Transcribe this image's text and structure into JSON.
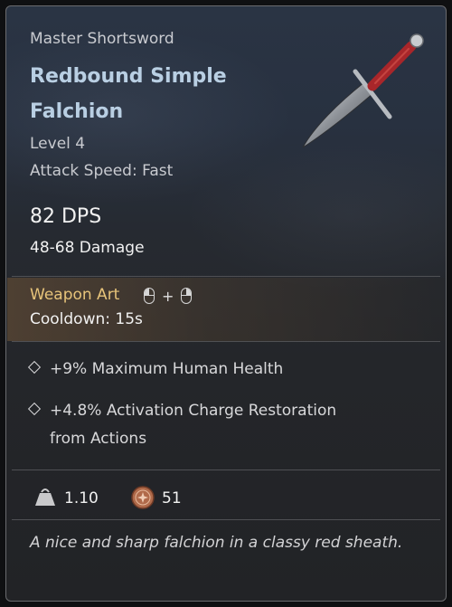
{
  "item": {
    "subtype": "Master Shortsword",
    "name": "Redbound Simple Falchion",
    "level": "Level 4",
    "attack_speed": "Attack Speed: Fast",
    "dps": "82 DPS",
    "damage": "48-68 Damage"
  },
  "weapon_art": {
    "title": "Weapon Art",
    "keys_plus": "+",
    "cooldown": "Cooldown: 15s",
    "icons": [
      "mouse-left-icon",
      "mouse-right-icon"
    ]
  },
  "perks": [
    {
      "text": "+9% Maximum Human Health"
    },
    {
      "text_line1": "+4.8% Activation Charge Restoration",
      "text_line2": "from Actions"
    }
  ],
  "stats": {
    "weight": "1.10",
    "price": "51",
    "icons": [
      "weight-icon",
      "coin-icon"
    ]
  },
  "description": "A nice and sharp falchion in a classy red sheath.",
  "colors": {
    "name": "#b9cfe3",
    "weapon_art_title": "#e7c47a",
    "coin": "#b06a4a",
    "sword_grip": "#b22d2a"
  }
}
